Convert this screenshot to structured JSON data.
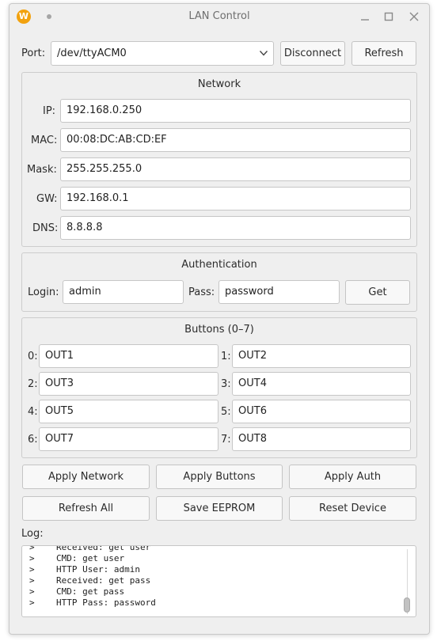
{
  "window": {
    "title": "LAN Control",
    "icon_letter": "W"
  },
  "port": {
    "label": "Port:",
    "value": "/dev/ttyACM0",
    "disconnect_label": "Disconnect",
    "refresh_label": "Refresh"
  },
  "network": {
    "title": "Network",
    "ip_label": "IP:",
    "ip": "192.168.0.250",
    "mac_label": "MAC:",
    "mac": "00:08:DC:AB:CD:EF",
    "mask_label": "Mask:",
    "mask": "255.255.255.0",
    "gw_label": "GW:",
    "gw": "192.168.0.1",
    "dns_label": "DNS:",
    "dns": "8.8.8.8"
  },
  "auth": {
    "title": "Authentication",
    "login_label": "Login:",
    "login": "admin",
    "pass_label": "Pass:",
    "pass": "password",
    "get_label": "Get"
  },
  "buttons_group": {
    "title": "Buttons (0–7)",
    "items": [
      {
        "label": "0:",
        "value": "OUT1"
      },
      {
        "label": "1:",
        "value": "OUT2"
      },
      {
        "label": "2:",
        "value": "OUT3"
      },
      {
        "label": "3:",
        "value": "OUT4"
      },
      {
        "label": "4:",
        "value": "OUT5"
      },
      {
        "label": "5:",
        "value": "OUT6"
      },
      {
        "label": "6:",
        "value": "OUT7"
      },
      {
        "label": "7:",
        "value": "OUT8"
      }
    ]
  },
  "actions": {
    "apply_network": "Apply Network",
    "apply_buttons": "Apply Buttons",
    "apply_auth": "Apply Auth",
    "refresh_all": "Refresh All",
    "save_eeprom": "Save EEPROM",
    "reset_device": "Reset Device"
  },
  "log": {
    "label": "Log:",
    "lines": [
      {
        "prefix": ">",
        "text": "Received: get user"
      },
      {
        "prefix": ">",
        "text": "CMD: get user"
      },
      {
        "prefix": ">",
        "text": "HTTP User: admin"
      },
      {
        "prefix": ">",
        "text": "Received: get pass"
      },
      {
        "prefix": ">",
        "text": "CMD: get pass"
      },
      {
        "prefix": ">",
        "text": "HTTP Pass: password"
      }
    ]
  }
}
